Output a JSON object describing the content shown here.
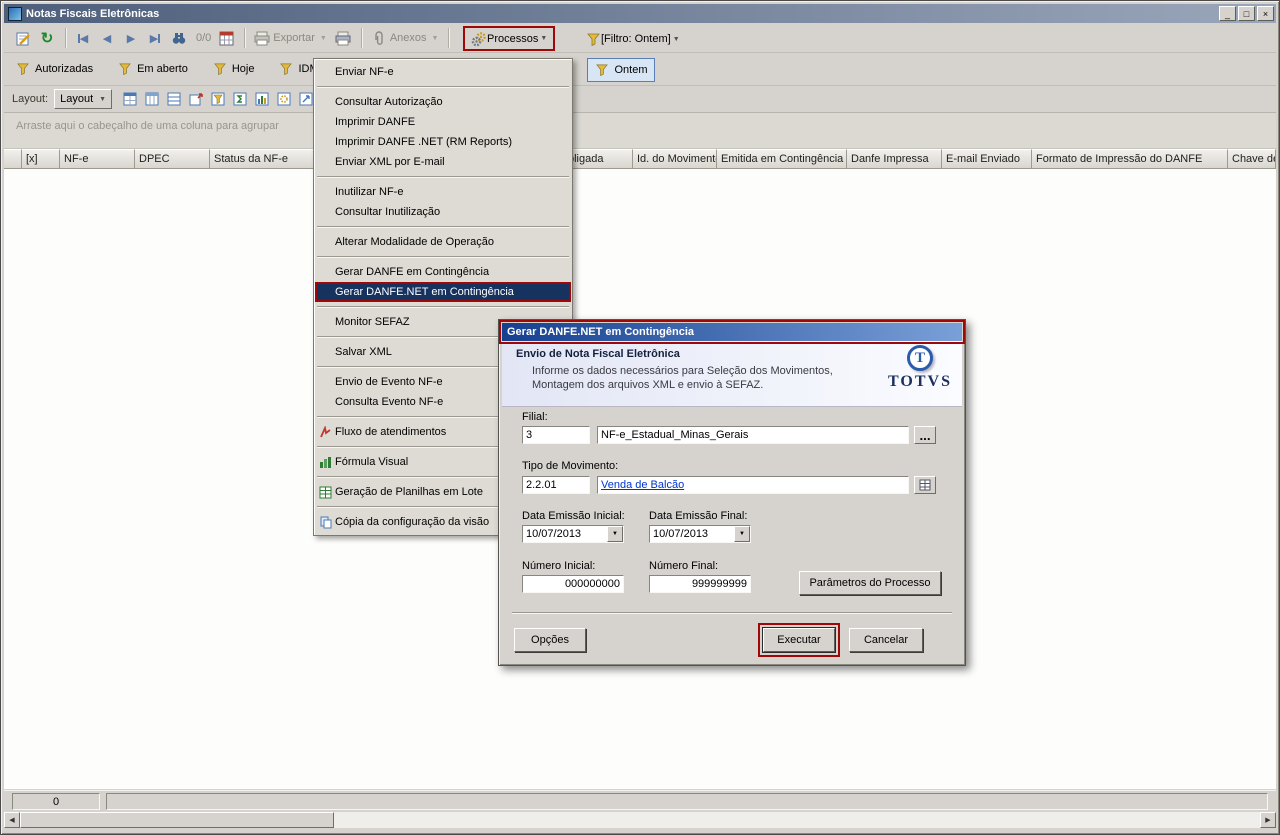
{
  "window": {
    "title": "Notas Fiscais Eletrônicas"
  },
  "icons": {
    "minimize": "_",
    "maximize": "□",
    "close": "×",
    "refresh": "↻",
    "nav_prev": "◀",
    "nav_next": "▶",
    "chevron": "▼",
    "scroll_left": "◀",
    "scroll_right": "▶",
    "ellipsis": "..."
  },
  "toolbar": {
    "find_count": "0/0",
    "exportar": "Exportar",
    "anexos": "Anexos",
    "processos": "Processos",
    "filtro": "[Filtro: Ontem]"
  },
  "filters": {
    "tabs": [
      "Autorizadas",
      "Em aberto",
      "Hoje",
      "IDM"
    ],
    "active": "Ontem"
  },
  "layout_bar": {
    "label": "Layout:",
    "dropdown": "Layout"
  },
  "grid": {
    "group_hint": "Arraste aqui o cabeçalho de uma coluna para agrupar",
    "columns": [
      "[x]",
      "NF-e",
      "DPEC",
      "Status da NF-e",
      "bligada",
      "Id. do Movimento",
      "Emitida em Contingência",
      "Danfe Impressa",
      "E-mail Enviado",
      "Formato de Impressão do DANFE",
      "Chave de A"
    ]
  },
  "menu": {
    "items": [
      "Enviar NF-e",
      "Consultar Autorização",
      "Imprimir DANFE",
      "Imprimir DANFE .NET (RM Reports)",
      "Enviar XML por E-mail",
      "Inutilizar NF-e",
      "Consultar Inutilização",
      "Alterar Modalidade de Operação",
      "Gerar DANFE em Contingência",
      "Gerar DANFE.NET em Contingência",
      "Monitor SEFAZ",
      "Salvar XML",
      "Envio de Evento NF-e",
      "Consulta Evento NF-e",
      "Fluxo de atendimentos",
      "Fórmula Visual",
      "Geração de Planilhas em Lote",
      "Cópia da configuração da visão"
    ],
    "selected": "Gerar DANFE.NET em Contingência"
  },
  "dialog": {
    "title": "Gerar DANFE.NET em Contingência",
    "header_title": "Envio de Nota Fiscal Eletrônica",
    "header_subtitle1": "Informe os dados necessários para Seleção dos Movimentos,",
    "header_subtitle2": "Montagem dos arquivos XML e envio à SEFAZ.",
    "logo_initial": "T",
    "logo_text": "TOTVS",
    "filial_label": "Filial:",
    "filial_code": "3",
    "filial_name": "NF-e_Estadual_Minas_Gerais",
    "tipo_label": "Tipo de Movimento:",
    "tipo_code": "2.2.01",
    "tipo_name": "Venda de Balcão",
    "data_inicial_label": "Data Emissão Inicial:",
    "data_inicial_value": "10/07/2013",
    "data_final_label": "Data Emissão Final:",
    "data_final_value": "10/07/2013",
    "numero_inicial_label": "Número Inicial:",
    "numero_inicial_value": "000000000",
    "numero_final_label": "Número Final:",
    "numero_final_value": "999999999",
    "parametros_button": "Parâmetros do Processo",
    "opcoes_button": "Opções",
    "executar_button": "Executar",
    "cancelar_button": "Cancelar"
  },
  "status_bar": {
    "count": "0"
  },
  "colors": {
    "annotation_red": "#a00707",
    "menu_selected": "#16325f",
    "link_blue": "#0033cc",
    "active_filter_bg": "#d7e5f5"
  }
}
